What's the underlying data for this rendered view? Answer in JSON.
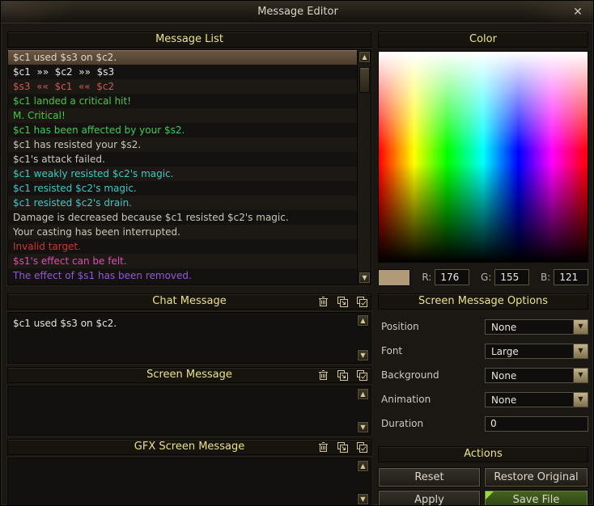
{
  "window": {
    "title": "Message Editor"
  },
  "icons": {
    "up_arrow": "▲",
    "down_arrow": "▼",
    "dropdown_arrow": "▼",
    "close": "✕",
    "header_icons": [
      "delete-icon",
      "paste-icon",
      "apply-check-icon"
    ]
  },
  "message_list": {
    "title": "Message List",
    "items": [
      {
        "text": "$c1 used $s3 on $c2.",
        "color": "#ded6c6",
        "selected": true
      },
      {
        "text": "$c1  »»  $c2  »»  $s3",
        "color": "#e7e3d9",
        "selected": false
      },
      {
        "text": "$s3  ««  $c1  ««  $c2",
        "color": "#c75a52",
        "selected": false
      },
      {
        "text": "$c1 landed a critical hit!",
        "color": "#3fcb41",
        "selected": false
      },
      {
        "text": "M. Critical!",
        "color": "#3fcb41",
        "selected": false
      },
      {
        "text": "$c1 has been affected by your $s2.",
        "color": "#3fcb55",
        "selected": false
      },
      {
        "text": "$c1 has resisted your $s2.",
        "color": "#ccc7ba",
        "selected": false
      },
      {
        "text": "$c1's attack failed.",
        "color": "#ccc7ba",
        "selected": false
      },
      {
        "text": "$c1 weakly resisted $c2's magic.",
        "color": "#3ec8c4",
        "selected": false
      },
      {
        "text": "$c1 resisted $c2's magic.",
        "color": "#3ec8c4",
        "selected": false
      },
      {
        "text": "$c1 resisted $c2's drain.",
        "color": "#3ec8c4",
        "selected": false
      },
      {
        "text": "Damage is decreased because $c1 resisted $c2's magic.",
        "color": "#ccc7ba",
        "selected": false
      },
      {
        "text": "Your casting has been interrupted.",
        "color": "#ccc7ba",
        "selected": false
      },
      {
        "text": "Invalid target.",
        "color": "#c6392d",
        "selected": false
      },
      {
        "text": "$s1's effect can be felt.",
        "color": "#e649b6",
        "selected": false
      },
      {
        "text": "The effect of $s1 has been removed.",
        "color": "#9257d8",
        "selected": false
      }
    ]
  },
  "color_panel": {
    "title": "Color",
    "swatch_color": "#b09b79",
    "r_label": "R:",
    "r_value": "176",
    "g_label": "G:",
    "g_value": "155",
    "b_label": "B:",
    "b_value": "121"
  },
  "chat_message": {
    "title": "Chat Message",
    "content": "$c1 used $s3 on $c2."
  },
  "screen_message": {
    "title": "Screen Message",
    "content": ""
  },
  "gfx_screen_message": {
    "title": "GFX Screen Message",
    "content": ""
  },
  "options": {
    "title": "Screen Message Options",
    "rows": [
      {
        "label": "Position",
        "value": "None"
      },
      {
        "label": "Font",
        "value": "Large"
      },
      {
        "label": "Background",
        "value": "None"
      },
      {
        "label": "Animation",
        "value": "None"
      }
    ],
    "duration_label": "Duration",
    "duration_value": "0"
  },
  "actions": {
    "title": "Actions",
    "buttons": [
      {
        "label": "Reset",
        "primary": false
      },
      {
        "label": "Restore Original",
        "primary": false
      },
      {
        "label": "Apply",
        "primary": false
      },
      {
        "label": "Save File",
        "primary": true
      }
    ]
  }
}
